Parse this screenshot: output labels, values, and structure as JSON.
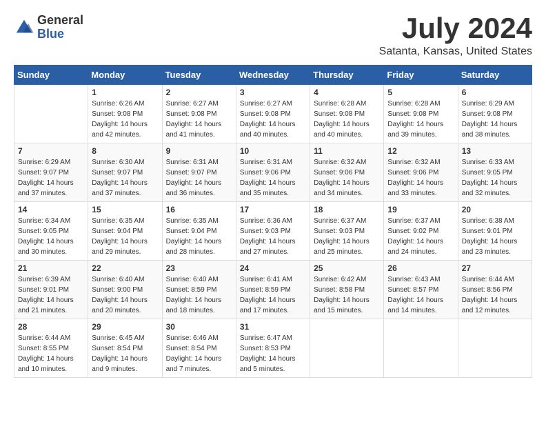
{
  "logo": {
    "general": "General",
    "blue": "Blue"
  },
  "title": "July 2024",
  "subtitle": "Satanta, Kansas, United States",
  "days_of_week": [
    "Sunday",
    "Monday",
    "Tuesday",
    "Wednesday",
    "Thursday",
    "Friday",
    "Saturday"
  ],
  "weeks": [
    [
      {
        "day": "",
        "sunrise": "",
        "sunset": "",
        "daylight": ""
      },
      {
        "day": "1",
        "sunrise": "Sunrise: 6:26 AM",
        "sunset": "Sunset: 9:08 PM",
        "daylight": "Daylight: 14 hours and 42 minutes."
      },
      {
        "day": "2",
        "sunrise": "Sunrise: 6:27 AM",
        "sunset": "Sunset: 9:08 PM",
        "daylight": "Daylight: 14 hours and 41 minutes."
      },
      {
        "day": "3",
        "sunrise": "Sunrise: 6:27 AM",
        "sunset": "Sunset: 9:08 PM",
        "daylight": "Daylight: 14 hours and 40 minutes."
      },
      {
        "day": "4",
        "sunrise": "Sunrise: 6:28 AM",
        "sunset": "Sunset: 9:08 PM",
        "daylight": "Daylight: 14 hours and 40 minutes."
      },
      {
        "day": "5",
        "sunrise": "Sunrise: 6:28 AM",
        "sunset": "Sunset: 9:08 PM",
        "daylight": "Daylight: 14 hours and 39 minutes."
      },
      {
        "day": "6",
        "sunrise": "Sunrise: 6:29 AM",
        "sunset": "Sunset: 9:08 PM",
        "daylight": "Daylight: 14 hours and 38 minutes."
      }
    ],
    [
      {
        "day": "7",
        "sunrise": "Sunrise: 6:29 AM",
        "sunset": "Sunset: 9:07 PM",
        "daylight": "Daylight: 14 hours and 37 minutes."
      },
      {
        "day": "8",
        "sunrise": "Sunrise: 6:30 AM",
        "sunset": "Sunset: 9:07 PM",
        "daylight": "Daylight: 14 hours and 37 minutes."
      },
      {
        "day": "9",
        "sunrise": "Sunrise: 6:31 AM",
        "sunset": "Sunset: 9:07 PM",
        "daylight": "Daylight: 14 hours and 36 minutes."
      },
      {
        "day": "10",
        "sunrise": "Sunrise: 6:31 AM",
        "sunset": "Sunset: 9:06 PM",
        "daylight": "Daylight: 14 hours and 35 minutes."
      },
      {
        "day": "11",
        "sunrise": "Sunrise: 6:32 AM",
        "sunset": "Sunset: 9:06 PM",
        "daylight": "Daylight: 14 hours and 34 minutes."
      },
      {
        "day": "12",
        "sunrise": "Sunrise: 6:32 AM",
        "sunset": "Sunset: 9:06 PM",
        "daylight": "Daylight: 14 hours and 33 minutes."
      },
      {
        "day": "13",
        "sunrise": "Sunrise: 6:33 AM",
        "sunset": "Sunset: 9:05 PM",
        "daylight": "Daylight: 14 hours and 32 minutes."
      }
    ],
    [
      {
        "day": "14",
        "sunrise": "Sunrise: 6:34 AM",
        "sunset": "Sunset: 9:05 PM",
        "daylight": "Daylight: 14 hours and 30 minutes."
      },
      {
        "day": "15",
        "sunrise": "Sunrise: 6:35 AM",
        "sunset": "Sunset: 9:04 PM",
        "daylight": "Daylight: 14 hours and 29 minutes."
      },
      {
        "day": "16",
        "sunrise": "Sunrise: 6:35 AM",
        "sunset": "Sunset: 9:04 PM",
        "daylight": "Daylight: 14 hours and 28 minutes."
      },
      {
        "day": "17",
        "sunrise": "Sunrise: 6:36 AM",
        "sunset": "Sunset: 9:03 PM",
        "daylight": "Daylight: 14 hours and 27 minutes."
      },
      {
        "day": "18",
        "sunrise": "Sunrise: 6:37 AM",
        "sunset": "Sunset: 9:03 PM",
        "daylight": "Daylight: 14 hours and 25 minutes."
      },
      {
        "day": "19",
        "sunrise": "Sunrise: 6:37 AM",
        "sunset": "Sunset: 9:02 PM",
        "daylight": "Daylight: 14 hours and 24 minutes."
      },
      {
        "day": "20",
        "sunrise": "Sunrise: 6:38 AM",
        "sunset": "Sunset: 9:01 PM",
        "daylight": "Daylight: 14 hours and 23 minutes."
      }
    ],
    [
      {
        "day": "21",
        "sunrise": "Sunrise: 6:39 AM",
        "sunset": "Sunset: 9:01 PM",
        "daylight": "Daylight: 14 hours and 21 minutes."
      },
      {
        "day": "22",
        "sunrise": "Sunrise: 6:40 AM",
        "sunset": "Sunset: 9:00 PM",
        "daylight": "Daylight: 14 hours and 20 minutes."
      },
      {
        "day": "23",
        "sunrise": "Sunrise: 6:40 AM",
        "sunset": "Sunset: 8:59 PM",
        "daylight": "Daylight: 14 hours and 18 minutes."
      },
      {
        "day": "24",
        "sunrise": "Sunrise: 6:41 AM",
        "sunset": "Sunset: 8:59 PM",
        "daylight": "Daylight: 14 hours and 17 minutes."
      },
      {
        "day": "25",
        "sunrise": "Sunrise: 6:42 AM",
        "sunset": "Sunset: 8:58 PM",
        "daylight": "Daylight: 14 hours and 15 minutes."
      },
      {
        "day": "26",
        "sunrise": "Sunrise: 6:43 AM",
        "sunset": "Sunset: 8:57 PM",
        "daylight": "Daylight: 14 hours and 14 minutes."
      },
      {
        "day": "27",
        "sunrise": "Sunrise: 6:44 AM",
        "sunset": "Sunset: 8:56 PM",
        "daylight": "Daylight: 14 hours and 12 minutes."
      }
    ],
    [
      {
        "day": "28",
        "sunrise": "Sunrise: 6:44 AM",
        "sunset": "Sunset: 8:55 PM",
        "daylight": "Daylight: 14 hours and 10 minutes."
      },
      {
        "day": "29",
        "sunrise": "Sunrise: 6:45 AM",
        "sunset": "Sunset: 8:54 PM",
        "daylight": "Daylight: 14 hours and 9 minutes."
      },
      {
        "day": "30",
        "sunrise": "Sunrise: 6:46 AM",
        "sunset": "Sunset: 8:54 PM",
        "daylight": "Daylight: 14 hours and 7 minutes."
      },
      {
        "day": "31",
        "sunrise": "Sunrise: 6:47 AM",
        "sunset": "Sunset: 8:53 PM",
        "daylight": "Daylight: 14 hours and 5 minutes."
      },
      {
        "day": "",
        "sunrise": "",
        "sunset": "",
        "daylight": ""
      },
      {
        "day": "",
        "sunrise": "",
        "sunset": "",
        "daylight": ""
      },
      {
        "day": "",
        "sunrise": "",
        "sunset": "",
        "daylight": ""
      }
    ]
  ]
}
